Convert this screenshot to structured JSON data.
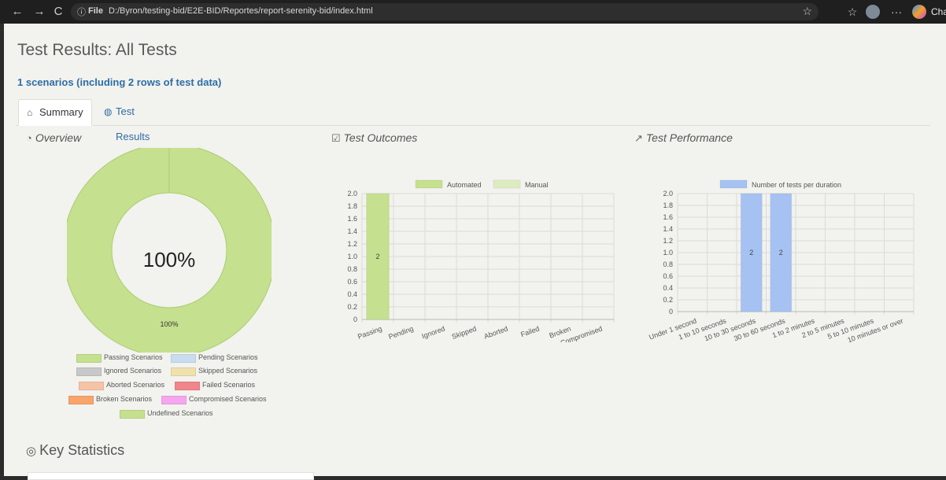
{
  "browser": {
    "nav": {
      "back": "←",
      "forward": "→",
      "reload": "C"
    },
    "address": {
      "info_icon": "ⓘ",
      "scheme": "File",
      "url": "D:/Byron/testing-bid/E2E-BID/Reportes/report-serenity-bid/index.html"
    },
    "right_label": "Chat",
    "icons": [
      "star-icon",
      "favorites-icon",
      "profile-avatar",
      "more-icon",
      "copilot-icon"
    ]
  },
  "page": {
    "title": "Test Results: All Tests",
    "subtitle": "1 scenarios (including 2 rows of test data)",
    "tabs": [
      {
        "label": "Summary",
        "icon": "home-icon",
        "active": true
      },
      {
        "label": "Test Results",
        "icon": "globe-icon",
        "active": false
      }
    ]
  },
  "sections": {
    "overview": "Overview",
    "outcomes": "Test Outcomes",
    "performance": "Test Performance",
    "key_statistics": "Key Statistics"
  },
  "overview_chart": {
    "center_label": "100%",
    "slice_label": "100%",
    "legend": [
      {
        "label": "Passing Scenarios",
        "color": "#c5e08e"
      },
      {
        "label": "Pending Scenarios",
        "color": "#c9dcf0"
      },
      {
        "label": "Ignored Scenarios",
        "color": "#c8c8c8"
      },
      {
        "label": "Skipped Scenarios",
        "color": "#efe0ae"
      },
      {
        "label": "Aborted Scenarios",
        "color": "#f7c3a7"
      },
      {
        "label": "Failed Scenarios",
        "color": "#f0858c"
      },
      {
        "label": "Broken Scenarios",
        "color": "#f8a46b"
      },
      {
        "label": "Compromised Scenarios",
        "color": "#f6a6ee"
      },
      {
        "label": "Undefined Scenarios",
        "color": "#c5e08e"
      }
    ]
  },
  "chart_data": [
    {
      "type": "pie",
      "title": "Overview",
      "categories": [
        "Passing Scenarios"
      ],
      "values": [
        100
      ],
      "unit": "%"
    },
    {
      "type": "bar",
      "title": "Test Outcomes",
      "categories": [
        "Passing",
        "Pending",
        "Ignored",
        "Skipped",
        "Aborted",
        "Failed",
        "Broken",
        "Compromised"
      ],
      "series": [
        {
          "name": "Automated",
          "color": "#c5e08e",
          "values": [
            2,
            0,
            0,
            0,
            0,
            0,
            0,
            0
          ]
        },
        {
          "name": "Manual",
          "color": "#dcecc0",
          "values": [
            0,
            0,
            0,
            0,
            0,
            0,
            0,
            0
          ]
        }
      ],
      "ylim": [
        0,
        2.0
      ],
      "yticks": [
        "0",
        "0.2",
        "0.4",
        "0.6",
        "0.8",
        "1.0",
        "1.2",
        "1.4",
        "1.6",
        "1.8",
        "2.0"
      ],
      "legend": "top",
      "grid": true
    },
    {
      "type": "bar",
      "title": "Test Performance",
      "categories": [
        "Under 1 second",
        "1 to 10 seconds",
        "10 to 30 seconds",
        "30 to 60 seconds",
        "1 to 2 minutes",
        "2 to 5 minutes",
        "5 to 10 minutes",
        "10 minutes or over"
      ],
      "series": [
        {
          "name": "Number of tests per duration",
          "color": "#a5c2f2",
          "values": [
            0,
            0,
            2,
            2,
            0,
            0,
            0,
            0
          ]
        }
      ],
      "ylim": [
        0,
        2.0
      ],
      "yticks": [
        "0",
        "0.2",
        "0.4",
        "0.6",
        "0.8",
        "1.0",
        "1.2",
        "1.4",
        "1.6",
        "1.8",
        "2.0"
      ],
      "legend": "top",
      "grid": true
    }
  ]
}
